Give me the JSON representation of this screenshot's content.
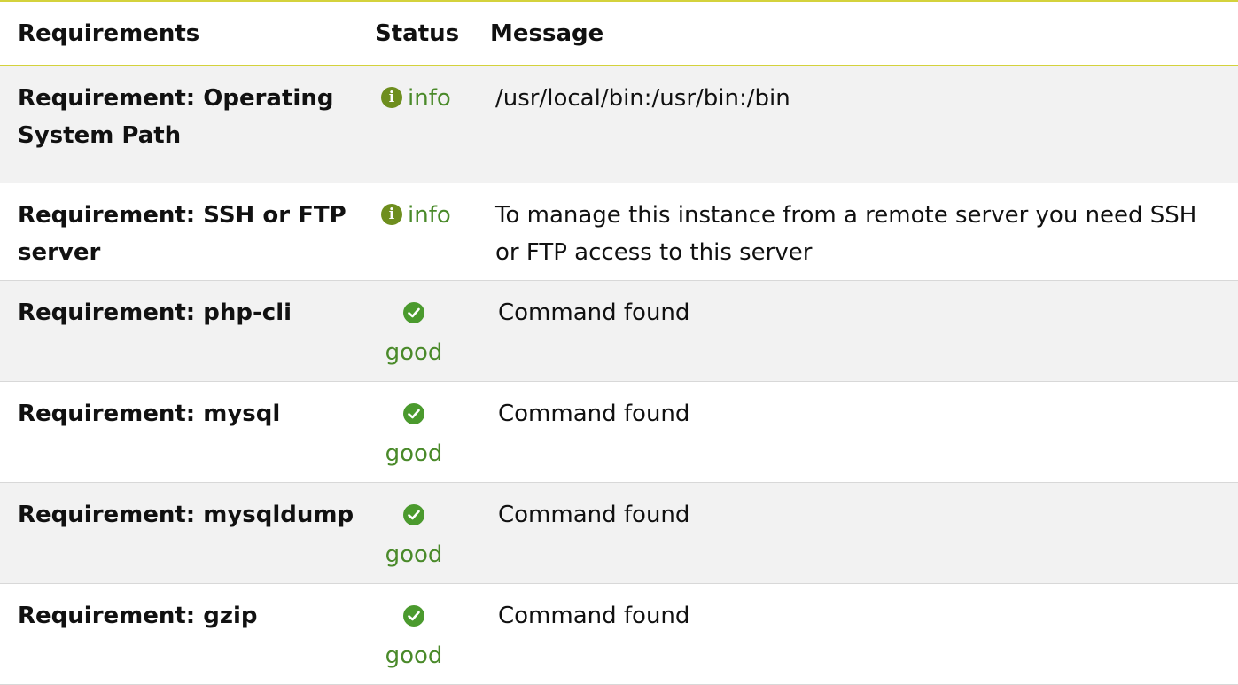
{
  "table": {
    "headers": {
      "requirements": "Requirements",
      "status": "Status",
      "message": "Message"
    },
    "rows": [
      {
        "name": "Requirement: Operating System Path",
        "status": "info",
        "status_icon": "info-icon",
        "message": "/usr/local/bin:/usr/bin:/bin"
      },
      {
        "name": "Requirement: SSH or FTP server",
        "status": "info",
        "status_icon": "info-icon",
        "message": "To manage this instance from a remote server you need SSH or FTP access to this server"
      },
      {
        "name": "Requirement: php-cli",
        "status": "good",
        "status_icon": "check-circle-icon",
        "message": "Command found"
      },
      {
        "name": "Requirement: mysql",
        "status": "good",
        "status_icon": "check-circle-icon",
        "message": "Command found"
      },
      {
        "name": "Requirement: mysqldump",
        "status": "good",
        "status_icon": "check-circle-icon",
        "message": "Command found"
      },
      {
        "name": "Requirement: gzip",
        "status": "good",
        "status_icon": "check-circle-icon",
        "message": "Command found"
      }
    ]
  },
  "colors": {
    "accent_border": "#d4d23c",
    "status_good": "#4b9a2e",
    "status_info": "#6e8e1e",
    "row_stripe": "#f2f2f2"
  }
}
